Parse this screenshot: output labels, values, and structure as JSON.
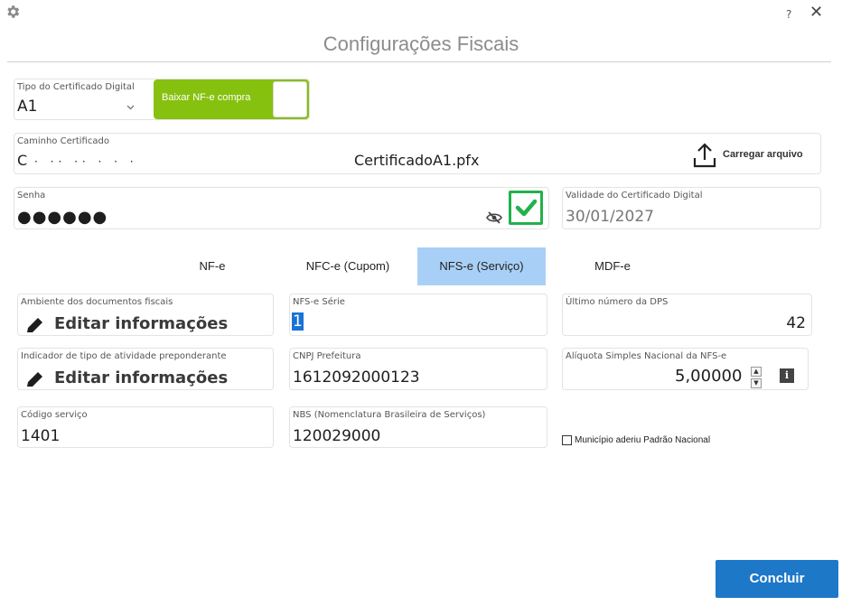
{
  "window": {
    "title": "Configurações Fiscais",
    "help_label": "?",
    "close_label": "✕"
  },
  "certificado": {
    "tipo_label": "Tipo do Certificado Digital",
    "tipo_value": "A1",
    "toggle_label": "Baixar NF-e compra",
    "caminho_label": "Caminho Certificado",
    "caminho_prefix": "C",
    "caminho_file": "CertificadoA1.pfx",
    "carregar_label": "Carregar arquivo",
    "senha_label": "Senha",
    "senha_value": "●●●●●●",
    "validade_label": "Validade do Certificado Digital",
    "validade_value": "30/01/2027"
  },
  "tabs": [
    {
      "label": "NF-e"
    },
    {
      "label": "NFC-e (Cupom)"
    },
    {
      "label": "NFS-e (Serviço)"
    },
    {
      "label": "MDF-e"
    }
  ],
  "nfse": {
    "ambiente_label": "Ambiente dos documentos fiscais",
    "ambiente_value": "Editar informações",
    "serie_label": "NFS-e Série",
    "serie_value": "1",
    "ultimo_label": "Último número da DPS",
    "ultimo_value": "42",
    "indicador_label": "Indicador de tipo de atividade preponderante",
    "indicador_value": "Editar informações",
    "cnpj_label": "CNPJ Prefeitura",
    "cnpj_value": "1612092000123",
    "aliquota_label": "Alíquota Simples Nacional da NFS-e",
    "aliquota_value": "5,00000",
    "codigo_label": "Código serviço",
    "codigo_value": "1401",
    "nbs_label": "NBS (Nomenclatura Brasileira de Serviços)",
    "nbs_value": "120029000",
    "municipio_label": "Município aderiu Padrão Nacional"
  },
  "actions": {
    "concluir_label": "Concluir"
  },
  "colors": {
    "toggle_green": "#86c10f",
    "check_green": "#22b14c",
    "tab_active": "#a8d0f7",
    "primary_button": "#1e78c8"
  }
}
